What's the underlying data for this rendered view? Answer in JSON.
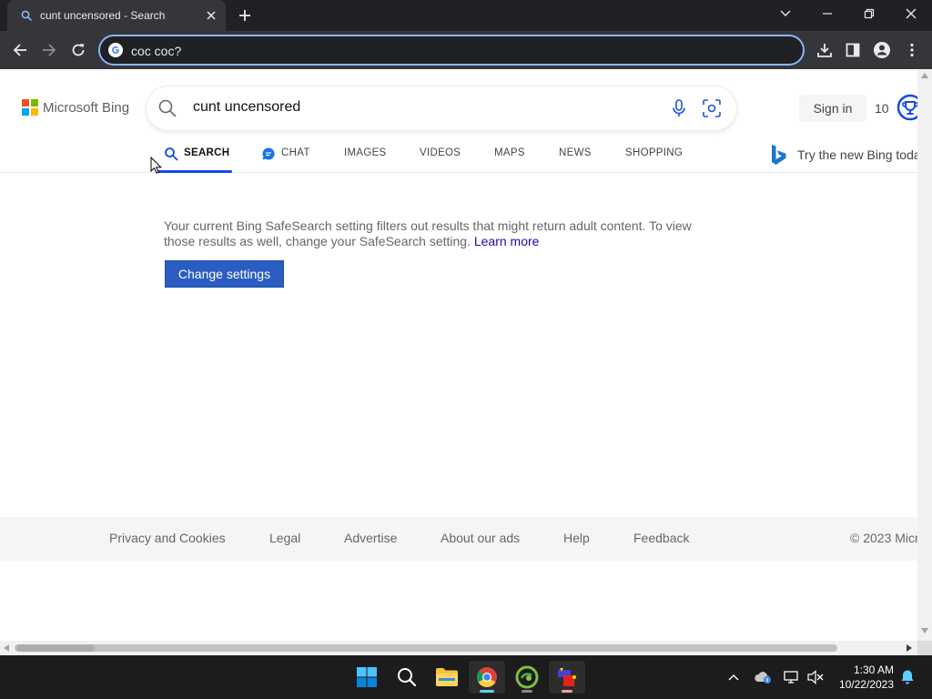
{
  "browser": {
    "tab": {
      "title": "cunt uncensored - Search"
    },
    "omnibox": {
      "value": "coc coc?"
    }
  },
  "bing": {
    "logo_text": "Microsoft Bing",
    "search_query": "cunt uncensored",
    "sign_in": "Sign in",
    "rewards_count": "10",
    "scopes": [
      {
        "label": "SEARCH"
      },
      {
        "label": "CHAT"
      },
      {
        "label": "IMAGES"
      },
      {
        "label": "VIDEOS"
      },
      {
        "label": "MAPS"
      },
      {
        "label": "NEWS"
      },
      {
        "label": "SHOPPING"
      }
    ],
    "try_new_bing": "Try the new Bing toda",
    "safesearch_message": "Your current Bing SafeSearch setting filters out results that might return adult content. To view those results as well, change your SafeSearch setting.",
    "learn_more": "Learn more",
    "change_settings": "Change settings",
    "footer_links": [
      {
        "label": "Privacy and Cookies"
      },
      {
        "label": "Legal"
      },
      {
        "label": "Advertise"
      },
      {
        "label": "About our ads"
      },
      {
        "label": "Help"
      },
      {
        "label": "Feedback"
      },
      {
        "label": "© 2023 Micr"
      }
    ]
  },
  "taskbar": {
    "time": "1:30 AM",
    "date": "10/22/2023"
  },
  "colors": {
    "chrome_dark": "#202124",
    "chrome_toolbar": "#35363a",
    "omnibox_focus": "#8ab4f8",
    "bing_blue": "#174ae4",
    "button_blue": "#2b5dc2",
    "link_blue": "#1a0dab",
    "taskbar": "#1c1c1c"
  }
}
